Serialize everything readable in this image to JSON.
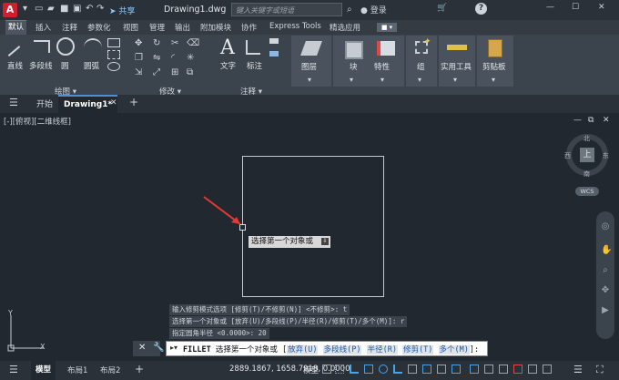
{
  "app": {
    "logo": "A",
    "share_label": "共享",
    "document_title": "Drawing1.dwg"
  },
  "search": {
    "placeholder": "键入关键字或短语"
  },
  "user": {
    "login_label": "登录"
  },
  "ribbon_tabs": [
    "默认",
    "插入",
    "注释",
    "参数化",
    "视图",
    "管理",
    "输出",
    "附加模块",
    "协作",
    "Express Tools",
    "精选应用"
  ],
  "ribbon": {
    "draw": {
      "tools": [
        "直线",
        "多段线",
        "圆",
        "圆弧"
      ],
      "panel_label": "绘图"
    },
    "modify": {
      "panel_label": "修改"
    },
    "annotation": {
      "tools": [
        "文字",
        "标注"
      ],
      "panel_label": "注释"
    },
    "layers_label": "图层",
    "block_label": "块",
    "properties_label": "特性",
    "group_label": "组",
    "utilities_label": "实用工具",
    "clipboard_label": "剪贴板"
  },
  "doc_tabs": {
    "start": "开始",
    "drawing": "Drawing1*"
  },
  "viewport": {
    "label": "[-][俯视][二维线框]"
  },
  "tooltip": {
    "text": "选择第一个对象或"
  },
  "viewcube": {
    "north": "北",
    "south": "南",
    "east": "东",
    "west": "西",
    "top": "上",
    "wcs": "WCS"
  },
  "command_history": [
    "输入修剪模式选项 [修剪(T)/不修剪(N)] <不修剪>: t",
    "选择第一个对象或 [放弃(U)/多段线(P)/半径(R)/修剪(T)/多个(M)]: r",
    "指定圆角半径 <0.0000>: 20"
  ],
  "command_line": {
    "command": "FILLET",
    "prompt": "选择第一个对象或",
    "options": [
      "放弃(U)",
      "多段线(P)",
      "半径(R)",
      "修剪(T)",
      "多个(M)"
    ],
    "suffix": "]:"
  },
  "status": {
    "layout_tabs": [
      "模型",
      "布局1",
      "布局2"
    ],
    "coordinates": "2889.1867, 1658.7918, 0.0000",
    "mode": "模型"
  },
  "ucs": {
    "x": "X",
    "y": "Y"
  }
}
